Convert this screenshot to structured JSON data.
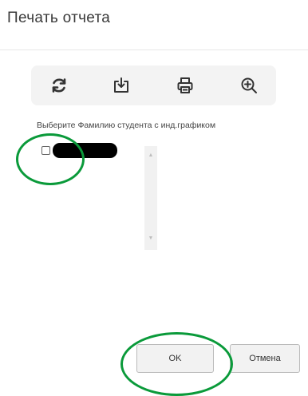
{
  "dialog": {
    "title": "Печать отчета"
  },
  "toolbar": {
    "buttons": [
      {
        "icon": "refresh-icon"
      },
      {
        "icon": "download-icon"
      },
      {
        "icon": "print-icon"
      },
      {
        "icon": "zoom-in-icon"
      }
    ]
  },
  "student_list": {
    "instruction": "Выберите Фамилию студента с инд.графиком",
    "items": [
      {
        "checked": false
      }
    ],
    "scroll_up_glyph": "▲",
    "scroll_down_glyph": "▼"
  },
  "footer": {
    "ok_label": "OK",
    "cancel_label": "Отмена"
  },
  "colors": {
    "annotation": "#0a9a3a",
    "toolbar_bg": "#f3f3f3"
  }
}
